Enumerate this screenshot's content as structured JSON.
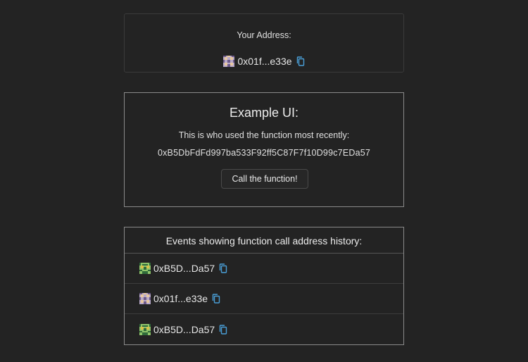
{
  "your_address": {
    "label": "Your Address:",
    "address": "0x01f...e33e",
    "avatar_icon": "blockie-purple-avatar",
    "copy_icon": "copy-icon"
  },
  "example_ui": {
    "title": "Example UI:",
    "description": "This is who used the function most recently:",
    "last_caller": "0xB5DbFdFd997ba533F92ff5C87F7f10D99c7EDa57",
    "button_label": "Call the function!"
  },
  "events": {
    "title": "Events showing function call address history:",
    "items": [
      {
        "address": "0xB5D...Da57",
        "avatar_icon": "blockie-green-avatar"
      },
      {
        "address": "0x01f...e33e",
        "avatar_icon": "blockie-purple-avatar"
      },
      {
        "address": "0xB5D...Da57",
        "avatar_icon": "blockie-green-avatar"
      }
    ]
  },
  "colors": {
    "background": "#232323",
    "copy_icon": "#4a9fd8",
    "border": "#8a8a8a"
  }
}
